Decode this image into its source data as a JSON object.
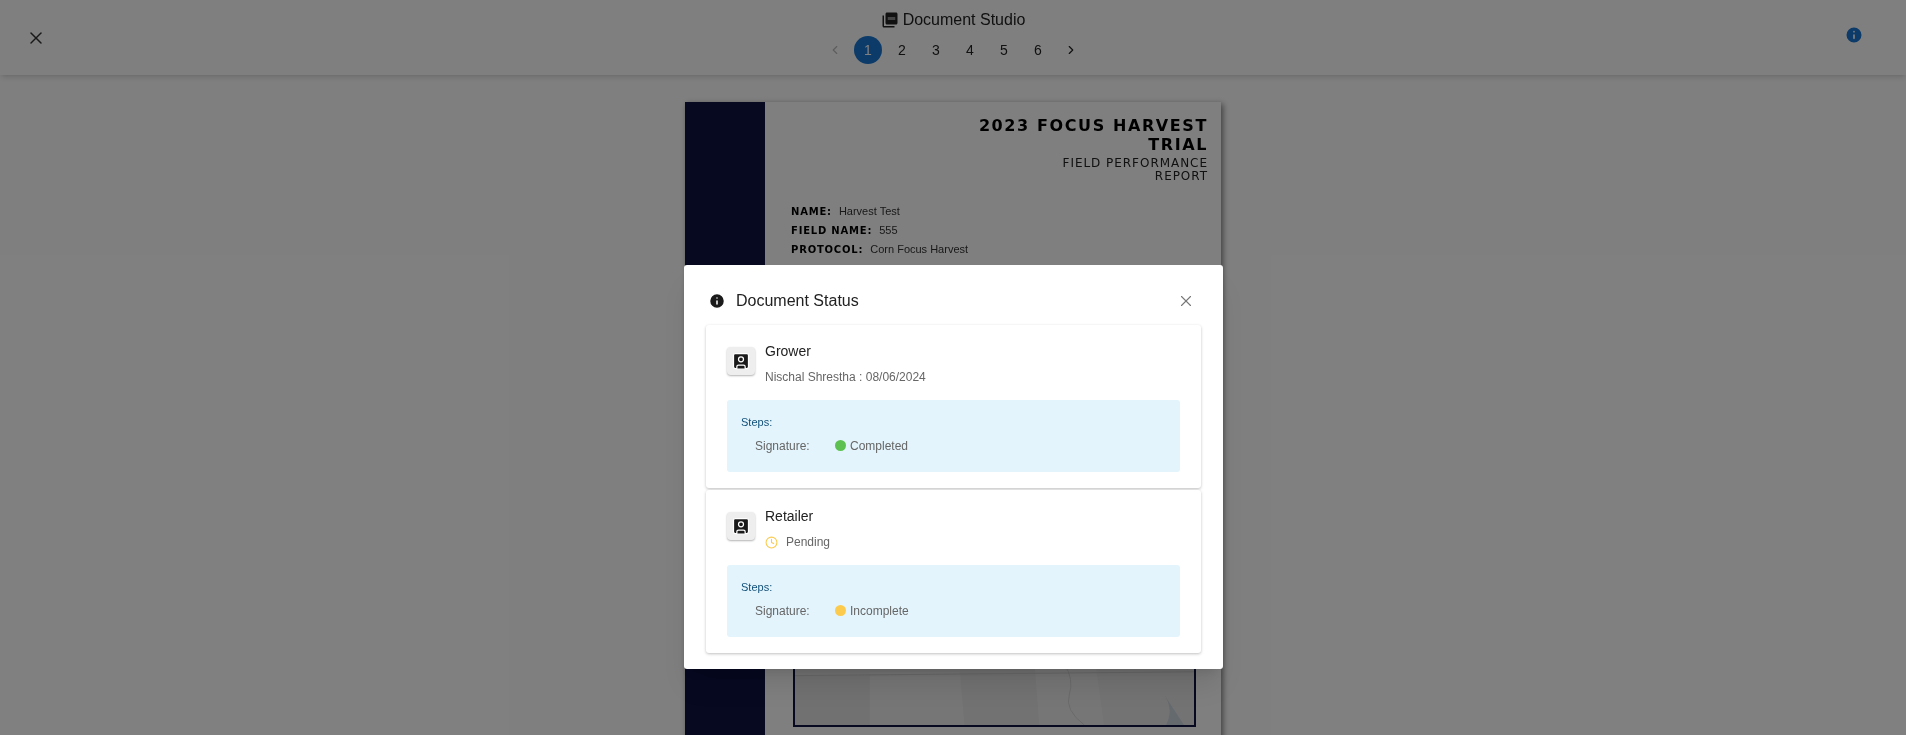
{
  "app": {
    "title": "Document Studio"
  },
  "pagination": {
    "previous": {
      "disabled": true
    },
    "next": {
      "disabled": false
    },
    "pages": [
      {
        "label": "1",
        "selected": true
      },
      {
        "label": "2",
        "selected": false
      },
      {
        "label": "3",
        "selected": false
      },
      {
        "label": "4",
        "selected": false
      },
      {
        "label": "5",
        "selected": false
      },
      {
        "label": "6",
        "selected": false
      }
    ]
  },
  "document": {
    "title": "2023 FOCUS HARVEST TRIAL",
    "subtitle": "FIELD PERFORMANCE REPORT",
    "fields": [
      {
        "label": "NAME:",
        "value": "Harvest Test"
      },
      {
        "label": "FIELD NAME:",
        "value": "555"
      },
      {
        "label": "PROTOCOL:",
        "value": "Corn Focus Harvest"
      }
    ]
  },
  "dialog": {
    "title": "Document Status",
    "parties": [
      {
        "role": "Grower",
        "kind": "signed",
        "detail": "Nischal Shrestha : 08/06/2024",
        "steps_label": "Steps:",
        "steps": [
          {
            "name": "Signature:",
            "status": "Completed",
            "color": "#5cc150"
          }
        ]
      },
      {
        "role": "Retailer",
        "kind": "pending",
        "detail": "Pending",
        "steps_label": "Steps:",
        "steps": [
          {
            "name": "Signature:",
            "status": "Incomplete",
            "color": "#fccb4e"
          }
        ]
      }
    ]
  }
}
